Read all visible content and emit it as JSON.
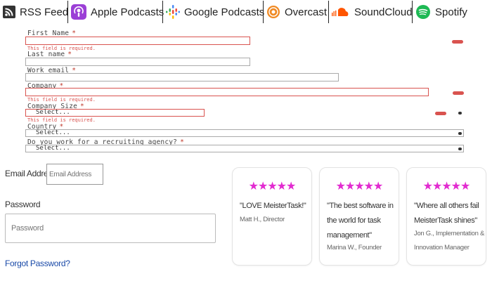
{
  "podcasts": [
    {
      "name": "RSS Feed",
      "icon": "rss-icon"
    },
    {
      "name": "Apple Podcasts",
      "icon": "apple-podcasts-icon"
    },
    {
      "name": "Google Podcasts",
      "icon": "google-podcasts-icon"
    },
    {
      "name": "Overcast",
      "icon": "overcast-icon"
    },
    {
      "name": "SoundCloud",
      "icon": "soundcloud-icon"
    },
    {
      "name": "Spotify",
      "icon": "spotify-icon"
    }
  ],
  "form": {
    "first_name": {
      "label": "First Name",
      "required": "*",
      "error": "This field is required."
    },
    "last_name": {
      "label": "Last name",
      "required": "*"
    },
    "work_email": {
      "label": "Work email",
      "required": "*"
    },
    "company": {
      "label": "Company",
      "required": "*",
      "error": "This field is required."
    },
    "company_size": {
      "label": "Company Size",
      "required": "*",
      "value": "Select...",
      "error": "This field is required."
    },
    "country": {
      "label": "Country",
      "required": "*",
      "value": "Select..."
    },
    "recruiting": {
      "label": "Do you work for a recruiting agency?",
      "required": "*",
      "value": "Select..."
    }
  },
  "login": {
    "email_label": "Email Address",
    "email_placeholder": "Email Address",
    "password_label": "Password",
    "password_placeholder": "Password",
    "forgot": "Forgot Password?"
  },
  "testimonials": [
    {
      "stars": "★★★★★",
      "quote": "\"LOVE MeisterTask!\"",
      "author": "Matt H., Director"
    },
    {
      "stars": "★★★★★",
      "quote": "\"The best software in the world for task management\"",
      "author": "Marina W., Founder"
    },
    {
      "stars": "★★★★★",
      "quote": "\"Where all others fail MeisterTask shines\"",
      "author": "Jon G., Implementation & Innovation Manager"
    }
  ],
  "colors": {
    "star": "#e22bd0",
    "error": "#d9534f",
    "link": "#1a4aa8",
    "rss": "#333333",
    "apple": "#9b3fd6",
    "overcast": "#f08a24",
    "soundcloud": "#ff5500",
    "spotify": "#1db954"
  }
}
